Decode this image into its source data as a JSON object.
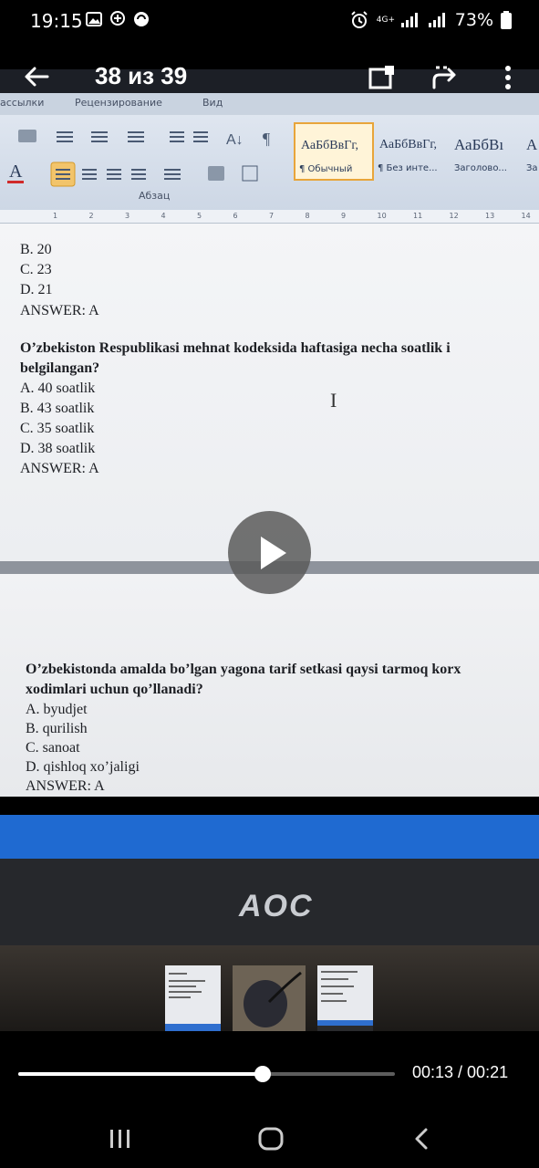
{
  "status_bar": {
    "time": "19:15",
    "network": "4G+",
    "battery": "73%"
  },
  "viewer": {
    "counter": "38 из 39",
    "icons": [
      "back-arrow-icon",
      "cast-icon",
      "share-icon",
      "more-vert-icon"
    ]
  },
  "word": {
    "tabs": [
      "ассылки",
      "Рецензирование",
      "Вид"
    ],
    "paragraph_group_label": "Абзац",
    "styles": [
      {
        "sample": "АаБбВвГг,",
        "name": "¶ Обычный",
        "selected": true
      },
      {
        "sample": "АаБбВвГг,",
        "name": "¶ Без инте...",
        "selected": false
      },
      {
        "sample": "АаБбВı",
        "name": "Заголово...",
        "selected": false
      },
      {
        "sample": "А",
        "name": "За",
        "selected": false
      }
    ],
    "ruler_numbers": [
      "1",
      "2",
      "3",
      "4",
      "5",
      "6",
      "7",
      "8",
      "9",
      "10",
      "11",
      "12",
      "13",
      "14"
    ]
  },
  "document": {
    "page1": {
      "lines": [
        {
          "text": "B. 20",
          "bold": false
        },
        {
          "text": "C. 23",
          "bold": false
        },
        {
          "text": "D. 21",
          "bold": false
        },
        {
          "text": "ANSWER: A",
          "bold": false
        },
        {
          "text": "O’zbekiston Respublikasi mehnat kodeksida haftasiga necha soatlik i",
          "bold": true
        },
        {
          "text": "belgilangan?",
          "bold": true
        },
        {
          "text": "A. 40 soatlik",
          "bold": false
        },
        {
          "text": "B. 43 soatlik",
          "bold": false
        },
        {
          "text": "C. 35 soatlik",
          "bold": false
        },
        {
          "text": "D. 38 soatlik",
          "bold": false
        },
        {
          "text": "ANSWER: A",
          "bold": false
        }
      ]
    },
    "page2": {
      "lines": [
        {
          "text": "O’zbekistonda amalda bo’lgan yagona tarif setkasi qaysi tarmoq korx",
          "bold": true
        },
        {
          "text": "xodimlari uchun qo’llanadi?",
          "bold": true
        },
        {
          "text": "A. byudjet",
          "bold": false
        },
        {
          "text": "B. qurilish",
          "bold": false
        },
        {
          "text": "C. sanoat",
          "bold": false
        },
        {
          "text": "D. qishloq xo’jaligi",
          "bold": false
        },
        {
          "text": "ANSWER: A",
          "bold": false
        }
      ]
    }
  },
  "monitor": {
    "brand": "AOC"
  },
  "player": {
    "time_readout": "00:13 / 00:21",
    "progress": 0.648,
    "play_icon": "play-icon"
  },
  "thumbnails": [
    "thumbnail-document",
    "thumbnail-hand",
    "thumbnail-document-monitor"
  ],
  "nav": [
    "recent-apps-icon",
    "home-icon",
    "back-icon"
  ]
}
